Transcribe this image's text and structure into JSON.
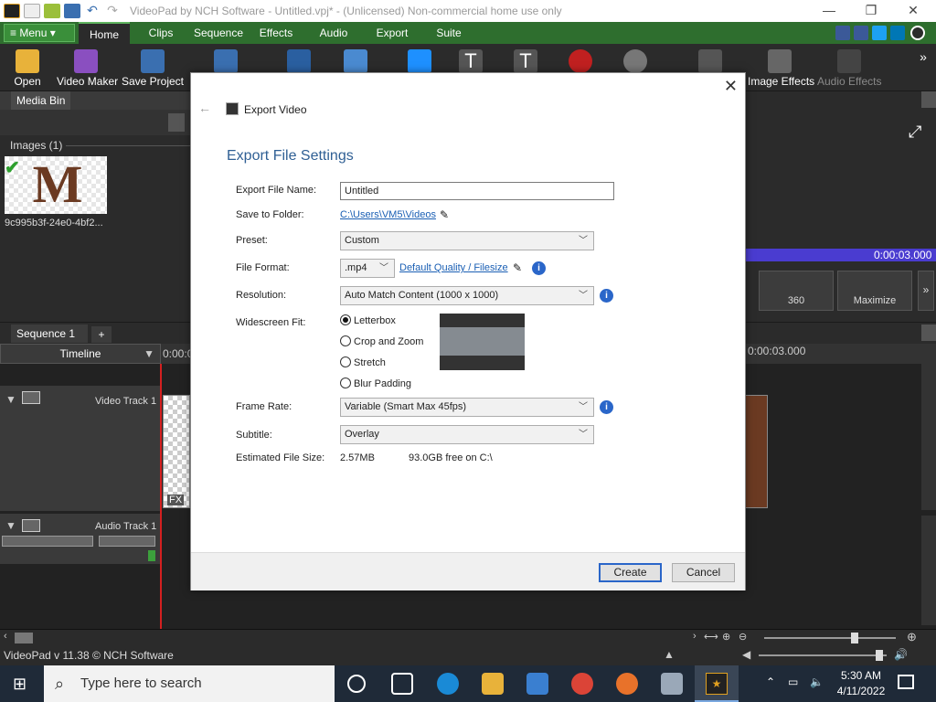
{
  "window": {
    "title": "VideoPad by NCH Software - Untitled.vpj* - (Unlicensed) Non-commercial home use only",
    "min": "—",
    "max": "❐",
    "close": "✕"
  },
  "tabs": {
    "menu_label": "Menu",
    "items": [
      "Home",
      "Clips",
      "Sequence",
      "Effects",
      "Audio",
      "Export",
      "Suite"
    ]
  },
  "toolbar": {
    "open": "Open",
    "video_maker": "Video Maker",
    "save_project": "Save Project",
    "image_effects": "Image Effects",
    "audio_effects": "Audio Effects"
  },
  "mediabin": {
    "tab": "Media Bin",
    "group": "Images (1)",
    "file_name": "9c995b3f-24e0-4bf2..."
  },
  "preview": {
    "time": "0:00:03.000",
    "btn_360": "360",
    "btn_maximize": "Maximize"
  },
  "sequence": {
    "tab": "Sequence 1",
    "add": "+",
    "timeline_label": "Timeline",
    "time_start": "0:00:0",
    "time_end": "0:00:03.000",
    "video_track": "Video Track 1",
    "audio_track": "Audio Track 1",
    "fx": "FX"
  },
  "status": {
    "version": "VideoPad v 11.38 © NCH Software"
  },
  "taskbar": {
    "search_placeholder": "Type here to search",
    "time": "5:30 AM",
    "date": "4/11/2022"
  },
  "dialog": {
    "title": "Export Video",
    "heading": "Export File Settings",
    "file_name_label": "Export File Name:",
    "file_name_value": "Untitled",
    "folder_label": "Save to Folder:",
    "folder_value": "C:\\Users\\VM5\\Videos",
    "preset_label": "Preset:",
    "preset_value": "Custom",
    "format_label": "File Format:",
    "format_value": ".mp4",
    "quality_link": "Default Quality / Filesize",
    "resolution_label": "Resolution:",
    "resolution_value": "Auto Match Content (1000 x 1000)",
    "widescreen_label": "Widescreen Fit:",
    "widescreen_options": [
      "Letterbox",
      "Crop and Zoom",
      "Stretch",
      "Blur Padding"
    ],
    "widescreen_selected": "Letterbox",
    "framerate_label": "Frame Rate:",
    "framerate_value": "Variable (Smart Max 45fps)",
    "subtitle_label": "Subtitle:",
    "subtitle_value": "Overlay",
    "size_label": "Estimated File Size:",
    "size_value": "2.57MB",
    "free_value": "93.0GB free on C:\\",
    "create": "Create",
    "cancel": "Cancel"
  }
}
